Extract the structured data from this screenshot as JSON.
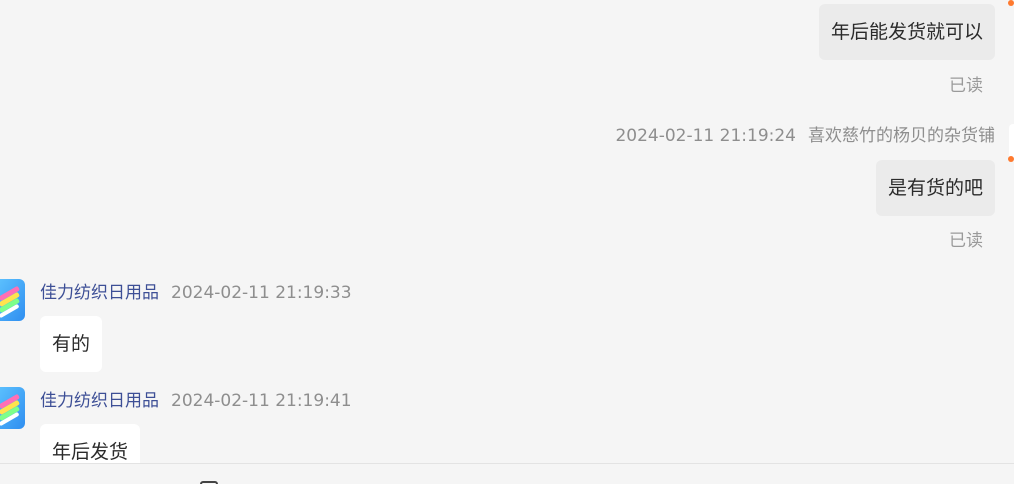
{
  "messages": {
    "m1": {
      "text": "年后能发货就可以",
      "status": "已读"
    },
    "m2": {
      "timestamp": "2024-02-11 21:19:24",
      "sender": "喜欢慈竹的杨贝的杂货铺",
      "text": "是有货的吧",
      "status": "已读"
    },
    "m3": {
      "sender": "佳力纺织日用品",
      "timestamp": "2024-02-11 21:19:33",
      "text": "有的",
      "avatar_icon": "store-avatar-icon"
    },
    "m4": {
      "sender": "佳力纺织日用品",
      "timestamp": "2024-02-11 21:19:41",
      "text": "年后发货",
      "avatar_icon": "store-avatar-icon"
    }
  },
  "colors": {
    "background": "#f5f5f5",
    "outgoing_bubble": "#ebebeb",
    "incoming_bubble": "#ffffff",
    "seller_name": "#3d4f96",
    "muted_text": "#8e8e8e",
    "accent_dot": "#ff7a2f"
  }
}
